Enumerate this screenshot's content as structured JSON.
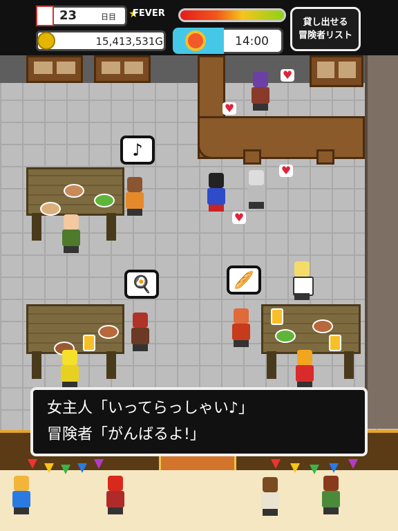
{
  "hud": {
    "day_number": "23",
    "day_unit": "日目",
    "fever_label": "FEVER",
    "fever_level": 0.95,
    "gold": "15,413,531G",
    "time": "14:00",
    "lend_button_line1": "貸し出せる",
    "lend_button_line2": "冒険者リスト"
  },
  "bubbles": {
    "music": "♪",
    "omelet": "🍳",
    "bread": "🥖"
  },
  "dialog": {
    "line1": "女主人「いってらっしゃい♪」",
    "line2": "冒険者「がんばるよ!」"
  },
  "colors": {
    "hud_bg": "#111111",
    "floor": "#bdbdbd",
    "wood": "#8a5a2a",
    "heart": "#e0233d",
    "fever_gradient": [
      "#e41c1c",
      "#f5c51b",
      "#8ed21a"
    ]
  },
  "icons": {
    "calendar": "calendar-icon",
    "star": "star-icon",
    "coin": "coin-icon",
    "sun": "sun-icon",
    "heart": "heart-icon"
  }
}
